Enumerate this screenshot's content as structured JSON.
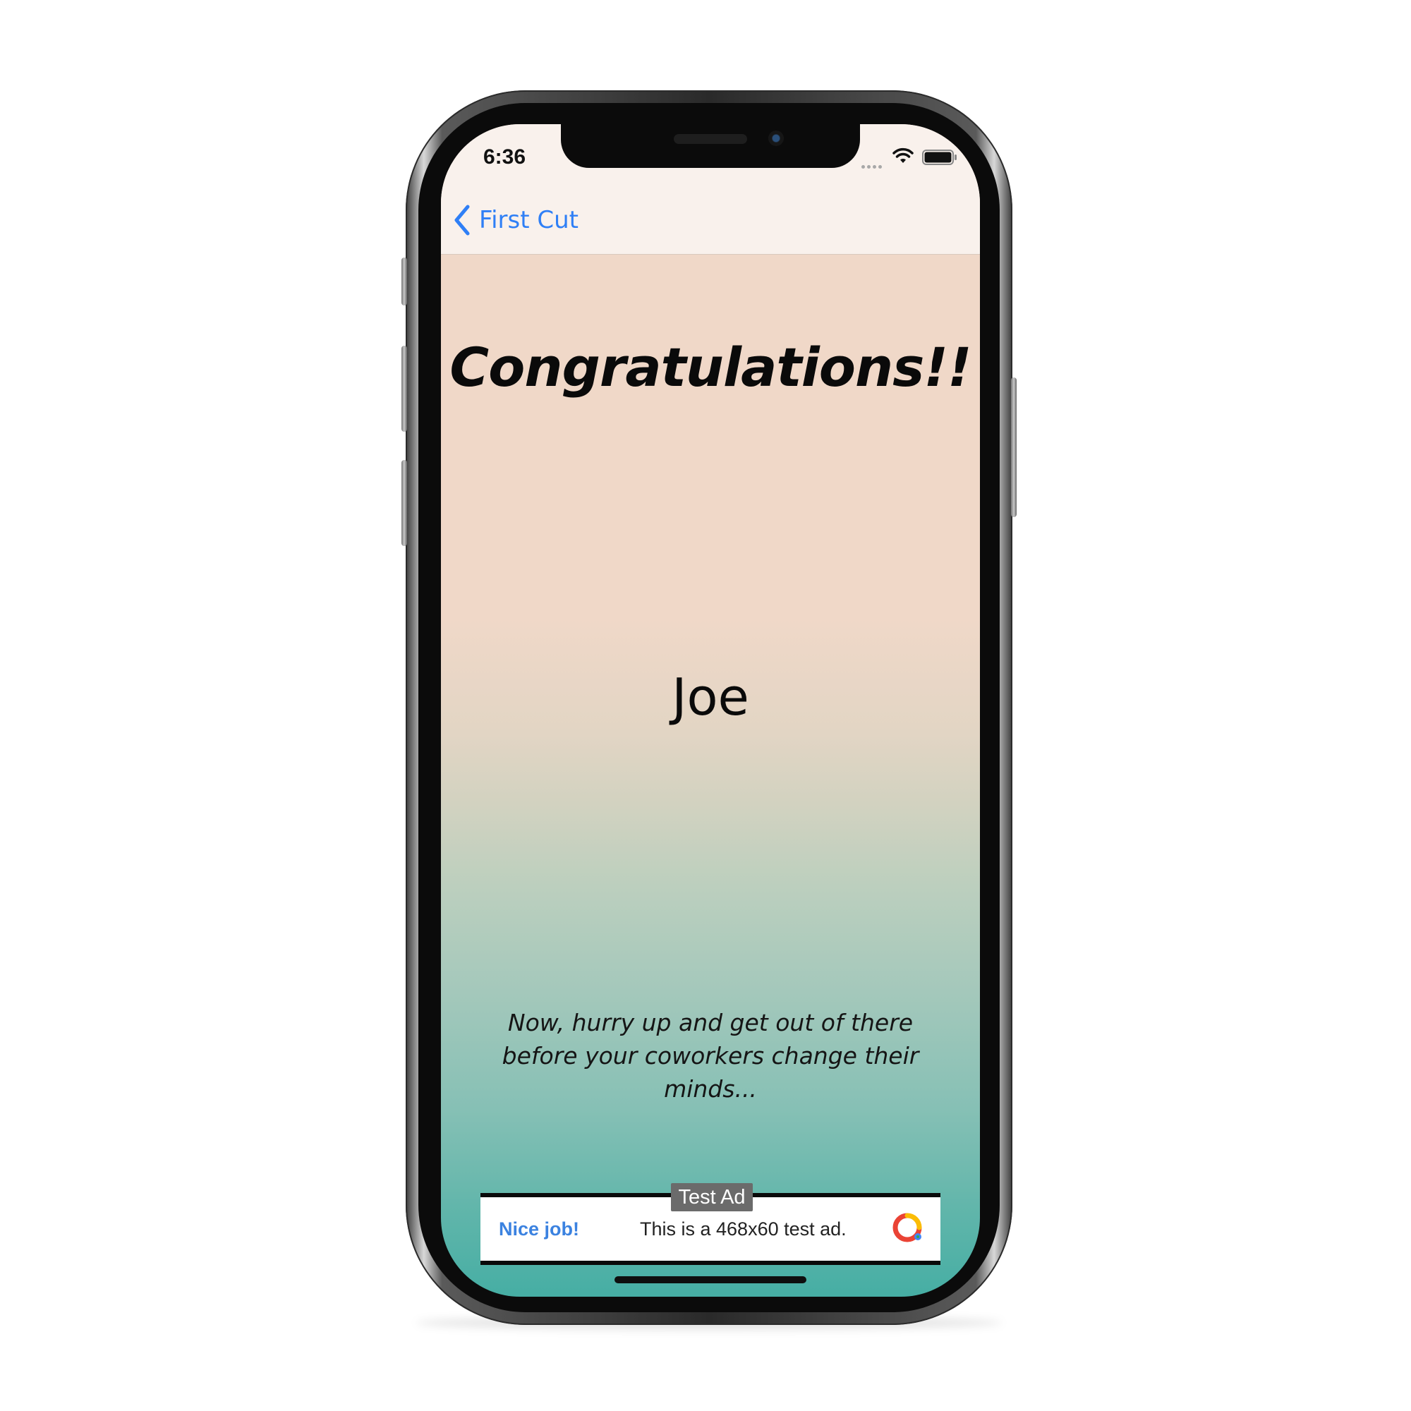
{
  "status_bar": {
    "time": "6:36"
  },
  "nav": {
    "back_label": "First Cut"
  },
  "content": {
    "headline": "Congratulations!!",
    "name": "Joe",
    "message": "Now, hurry up and get out of there before your coworkers change their minds..."
  },
  "ad": {
    "badge": "Test Ad",
    "headline": "Nice job!",
    "body": "This is a 468x60 test ad."
  },
  "icons": {
    "back": "chevron-left-icon",
    "wifi": "wifi-icon",
    "battery": "battery-icon",
    "ad_logo": "google-ads-logo-icon"
  },
  "colors": {
    "link_blue": "#2f7ff6",
    "ad_headline_blue": "#3b82e0",
    "gradient_top": "#f0d8c8",
    "gradient_bottom": "#46aea4"
  }
}
